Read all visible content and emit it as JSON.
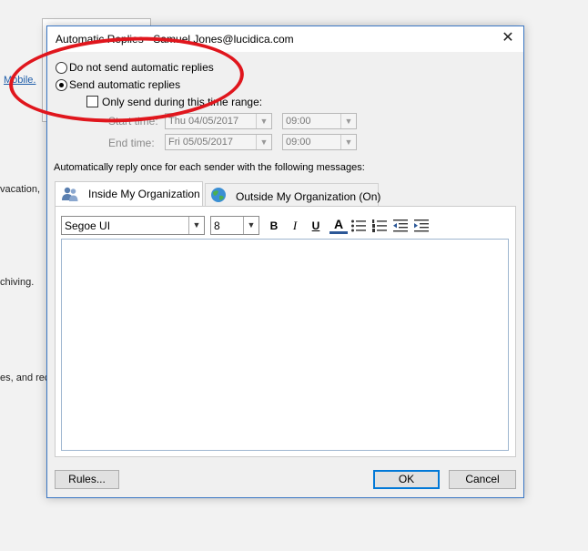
{
  "background": {
    "link_text": "Mobile.",
    "line1": "vacation,",
    "line2": "chiving.",
    "line3": "es, and rec"
  },
  "dialog": {
    "title": "Automatic Replies - Samuel.Jones@lucidica.com",
    "close_glyph": "✕",
    "radio_off_label": "Do not send automatic replies",
    "radio_on_label": "Send automatic replies",
    "time_range_label": "Only send during this time range:",
    "start_label": "Start time:",
    "start_date": "Thu 04/05/2017",
    "start_time": "09:00",
    "end_label": "End time:",
    "end_date": "Fri 05/05/2017",
    "end_time": "09:00",
    "reply_once_label": "Automatically reply once for each sender with the following messages:",
    "tab_inside": "Inside My Organization",
    "tab_outside": "Outside My Organization (On)",
    "font_name": "Segoe UI",
    "font_size": "8",
    "fmt_bold": "B",
    "fmt_italic": "I",
    "fmt_underline": "U",
    "fmt_color": "A",
    "rules_button": "Rules...",
    "ok_button": "OK",
    "cancel_button": "Cancel"
  },
  "colors": {
    "annotation": "#e0161d",
    "accent": "#0078d7"
  }
}
